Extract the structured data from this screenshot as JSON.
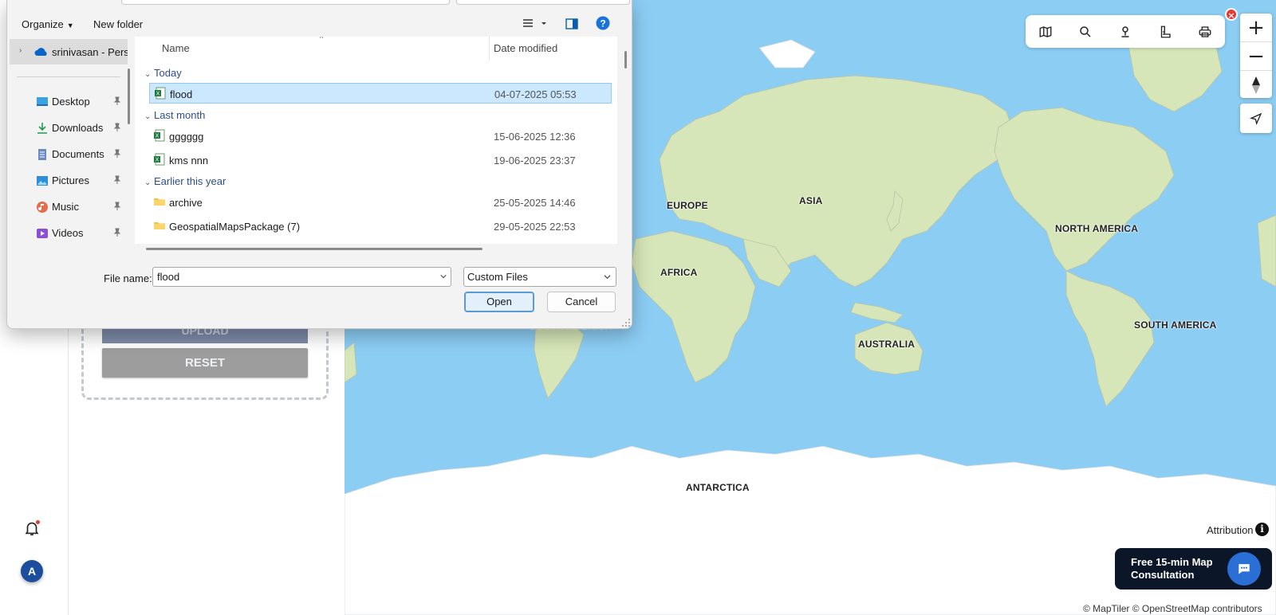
{
  "colors": {
    "ocean": "#8ccdf4",
    "land": "#d7e6b8",
    "ice": "#ffffff",
    "accent": "#0078d4",
    "selection": "#cce8ff"
  },
  "app": {
    "user_initial": "A",
    "upload_label": "UPLOAD",
    "reset_label": "RESET"
  },
  "map": {
    "labels": [
      "EUROPE",
      "ASIA",
      "NORTH AMERICA",
      "AFRICA",
      "SOUTH AMERICA",
      "SOUTH AMERICA",
      "AUSTRALIA",
      "ANTARCTICA"
    ],
    "attribution": "Attribution",
    "promo": {
      "line1": "Free 15-min Map",
      "line2": "Consultation"
    },
    "copyright": "© MapTiler © OpenStreetMap contributors",
    "tools": [
      "map-layers-icon",
      "search-icon",
      "location-pin-icon",
      "measure-icon",
      "print-icon"
    ]
  },
  "dialog": {
    "toolbar": {
      "organize": "Organize",
      "new_folder": "New folder"
    },
    "nav": {
      "onedrive": "srinivasan - Personal",
      "items": [
        {
          "label": "Desktop",
          "icon": "desktop-icon"
        },
        {
          "label": "Downloads",
          "icon": "download-icon"
        },
        {
          "label": "Documents",
          "icon": "documents-icon"
        },
        {
          "label": "Pictures",
          "icon": "pictures-icon"
        },
        {
          "label": "Music",
          "icon": "music-icon"
        },
        {
          "label": "Videos",
          "icon": "videos-icon"
        }
      ]
    },
    "columns": {
      "name": "Name",
      "date": "Date modified"
    },
    "groups": [
      {
        "label": "Today",
        "files": [
          {
            "name": "flood",
            "date": "04-07-2025 05:53",
            "type": "excel",
            "selected": true
          }
        ]
      },
      {
        "label": "Last month",
        "files": [
          {
            "name": "gggggg",
            "date": "15-06-2025 12:36",
            "type": "excel"
          },
          {
            "name": "kms nnn",
            "date": "19-06-2025 23:37",
            "type": "excel"
          }
        ]
      },
      {
        "label": "Earlier this year",
        "files": [
          {
            "name": "archive",
            "date": "25-05-2025 14:46",
            "type": "folder"
          },
          {
            "name": "GeospatialMapsPackage (7)",
            "date": "29-05-2025 22:53",
            "type": "folder"
          }
        ]
      }
    ],
    "file_name_label": "File name:",
    "file_name_value": "flood",
    "file_type": "Custom Files",
    "open_label": "Open",
    "cancel_label": "Cancel"
  }
}
